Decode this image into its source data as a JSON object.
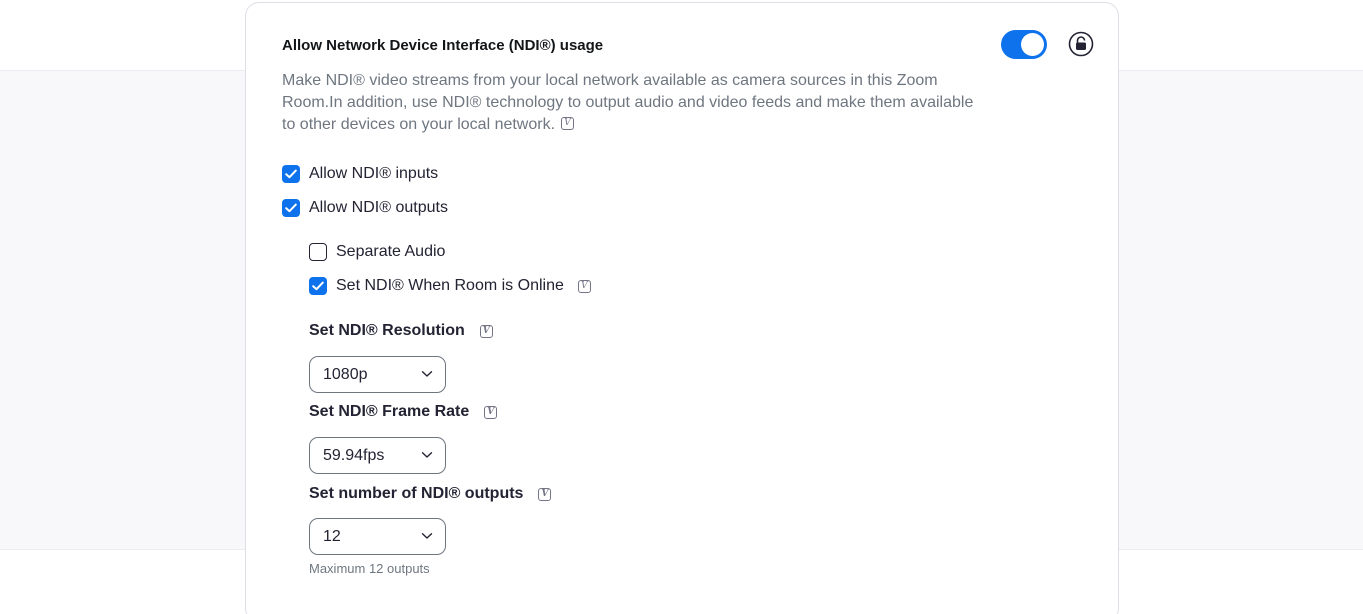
{
  "setting": {
    "title": "Allow Network Device Interface (NDI®) usage",
    "description": "Make NDI® video streams from your local network available as camera sources in this Zoom Room.In addition, use NDI® technology to output audio and video feeds and make them available to other devices on your local network.",
    "enabled": true
  },
  "options": {
    "inputs_label": "Allow NDI® inputs",
    "outputs_label": "Allow NDI® outputs",
    "separate_audio_label": "Separate Audio",
    "set_when_online_label": "Set NDI® When Room is Online"
  },
  "resolution": {
    "label": "Set NDI® Resolution",
    "value": "1080p"
  },
  "frame_rate": {
    "label": "Set NDI® Frame Rate",
    "value": "59.94fps"
  },
  "outputs_count": {
    "label": "Set number of NDI® outputs",
    "value": "12",
    "helper": "Maximum 12 outputs"
  },
  "colors": {
    "accent": "#0e72ed",
    "text": "#232333",
    "muted": "#6e7680"
  }
}
